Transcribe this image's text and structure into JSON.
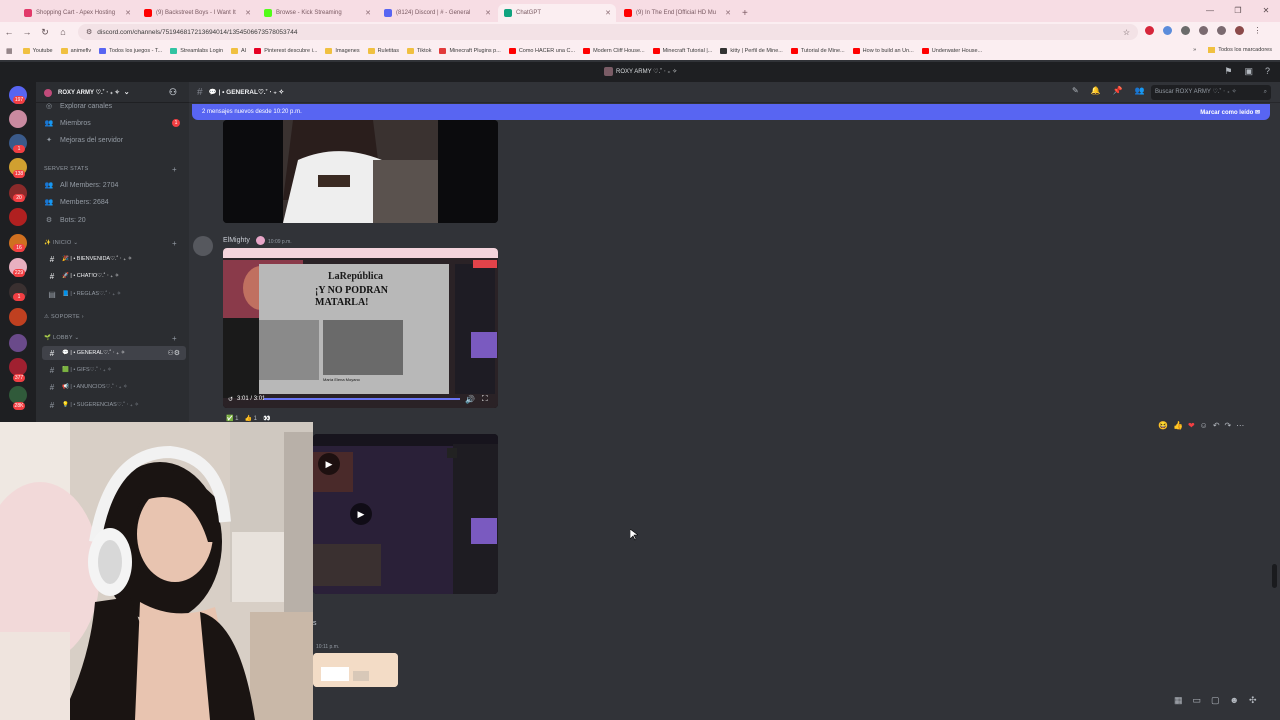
{
  "browser": {
    "tabs": [
      {
        "title": "Shopping Cart - Apex Hosting",
        "color": "#e23a6a"
      },
      {
        "title": "(9) Backstreet Boys - I Want It",
        "color": "#ff0000"
      },
      {
        "title": "Browse - Kick Streaming",
        "color": "#53fc18"
      },
      {
        "title": "(8124) Discord | # - General",
        "color": "#5865f2"
      },
      {
        "title": "ChatGPT",
        "color": "#10a37f"
      },
      {
        "title": "(9) In The End [Official HD Mu",
        "color": "#ff0000"
      }
    ],
    "new_tab": "+",
    "url": "discord.com/channels/751946817213694014/1354506673578053744",
    "bookmarks": [
      {
        "label": "Youtube",
        "color": "#f0c040"
      },
      {
        "label": "animeflv",
        "color": "#f0c040"
      },
      {
        "label": "Todos los juegos - T...",
        "color": "#5865f2"
      },
      {
        "label": "Streamlabs Login",
        "color": "#31c3a2"
      },
      {
        "label": "AI",
        "color": "#f0c040"
      },
      {
        "label": "Pinterest descubre i...",
        "color": "#e60023"
      },
      {
        "label": "Imagenes",
        "color": "#f0c040"
      },
      {
        "label": "Ruletitas",
        "color": "#f0c040"
      },
      {
        "label": "Tiktok",
        "color": "#f0c040"
      },
      {
        "label": "Minecraft Plugins p...",
        "color": "#e23a3a"
      },
      {
        "label": "Como HACER una C...",
        "color": "#ff0000"
      },
      {
        "label": "Modern Cliff House...",
        "color": "#ff0000"
      },
      {
        "label": "Minecraft Tutorial |...",
        "color": "#ff0000"
      },
      {
        "label": "kitty | Perfil de Mine...",
        "color": "#333333"
      },
      {
        "label": "Tutorial de Mine...",
        "color": "#ff0000"
      },
      {
        "label": "How to build an Un...",
        "color": "#ff0000"
      },
      {
        "label": "Underwater House...",
        "color": "#ff0000"
      }
    ],
    "bookmarks_right": "Todos los marcadores"
  },
  "discord": {
    "title": "ROXY ARMY ♡.˚ ‧ ₊ ✧",
    "server_name": "ROXY ARMY ♡.˚ ‧ ₊ ✧",
    "guild_badges": [
      "197",
      "1",
      "138",
      "20",
      "16",
      "229",
      "1",
      "377",
      "28K"
    ],
    "top_channels": {
      "explore": "Explorar canales",
      "members": "Miembros",
      "members_count": "1",
      "boosts": "Mejoras del servidor"
    },
    "categories": {
      "stats": "SERVER STATS",
      "inicio": "✨ INICIO ⌄",
      "soporte": "⚠ SOPORTE ›",
      "lobby": "🌱 LOBBY ⌄"
    },
    "stats": [
      "All Members: 2704",
      "Members: 2684",
      "Bots: 20"
    ],
    "inicio_channels": [
      "🎉 | • BIENVENIDA♡.˚ ‧ ₊ ✧",
      "🚀 | • CHAT!O♡.˚ ‧ ₊ ✧",
      "📘 | • REGLAS♡.˚ ‧ ₊ ✧"
    ],
    "lobby_channels": [
      "💬 | • GENERAL♡.˚ ‧ ₊ ✧",
      "🟩 | • GIFS♡.˚ ‧ ₊ ✧",
      "📢 | • ANUNCIOS♡.˚ ‧ ₊ ✧",
      "💡 | • SUGERENCIAS♡.˚ ‧ ₊ ✧"
    ],
    "channel_header": "💬 | • GENERAL♡.˚ ‧ ₊ ✧",
    "search_placeholder": "Buscar ROXY ARMY ♡.˚ ‧ ₊ ✧",
    "new_messages": "2 mensajes nuevos desde 10:20 p.m.",
    "mark_read": "Marcar como leído",
    "message": {
      "author": "ElMighty",
      "time": "10:09 p.m.",
      "video_time": "3:01 / 3:01",
      "reactions": [
        "✅ 1",
        "👍 1",
        "👀"
      ]
    },
    "newspaper": {
      "masthead": "LaRepública",
      "headline": "¡Y NO PODRAN MATARLA!",
      "caption": "María Elena Moyano"
    },
    "later_time": "10:11 p.m.",
    "partial_name": "s"
  }
}
